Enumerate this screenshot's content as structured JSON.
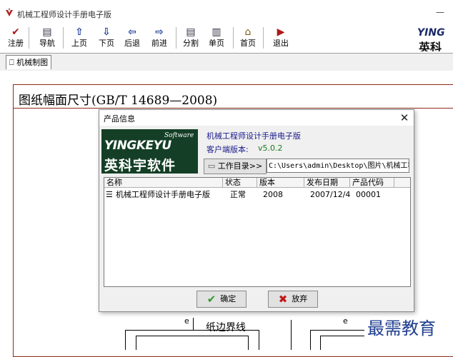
{
  "window": {
    "title": "机械工程师设计手册电子版",
    "minimize_glyph": "—"
  },
  "toolbar": {
    "items": [
      {
        "label": "注册",
        "icon": "register-check-icon",
        "glyph": "✔"
      },
      {
        "label": "导航",
        "icon": "navigation-icon",
        "glyph": "▤"
      },
      {
        "label": "上页",
        "icon": "arrow-up-icon",
        "glyph": "⇧"
      },
      {
        "label": "下页",
        "icon": "arrow-down-icon",
        "glyph": "⇩"
      },
      {
        "label": "后退",
        "icon": "arrow-left-icon",
        "glyph": "⇦"
      },
      {
        "label": "前进",
        "icon": "arrow-right-icon",
        "glyph": "⇨"
      },
      {
        "label": "分割",
        "icon": "split-view-icon",
        "glyph": "▤"
      },
      {
        "label": "单页",
        "icon": "single-page-icon",
        "glyph": "▥"
      },
      {
        "label": "首页",
        "icon": "home-icon",
        "glyph": "⌂"
      },
      {
        "label": "退出",
        "icon": "exit-door-icon",
        "glyph": "▶"
      }
    ],
    "brand_latin": "YING",
    "brand_cn": "英科"
  },
  "tabs": [
    {
      "label": "机械制图",
      "icon": "book-icon"
    }
  ],
  "document": {
    "title": "图纸幅面尺寸(GB/T 14689—2008)",
    "edge_label": "纸边界线"
  },
  "dialog": {
    "title": "产品信息",
    "close_glyph": "✕",
    "logo": {
      "software": "Software",
      "latin": "YINGKEYU",
      "cn": "英科宇软件"
    },
    "product_name": "机械工程师设计手册电子版",
    "version_label": "客户端版本:",
    "version_value": "v5.0.2",
    "workdir_button": "工作目录>>",
    "workdir_path": "C:\\Users\\admin\\Desktop\\图片\\机械工程",
    "list": {
      "columns": [
        "名称",
        "状态",
        "版本",
        "发布日期",
        "产品代码"
      ],
      "rows": [
        {
          "name": "机械工程师设计手册电子版",
          "status": "正常",
          "version": "2008",
          "date": "2007/12/4",
          "code": "00001"
        }
      ]
    },
    "ok_label": "确定",
    "cancel_label": "放弃"
  },
  "watermark": "最需教育",
  "colors": {
    "doc_border": "#8b2a1a",
    "logo_bg": "#143f26",
    "link_blue": "#1a1a8c",
    "version_green": "#1a7a1a",
    "ok_green": "#2e9a2e",
    "cancel_red": "#c01818",
    "watermark_blue": "#1f3d8f"
  }
}
